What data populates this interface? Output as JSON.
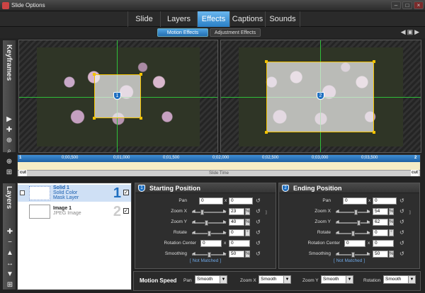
{
  "window": {
    "title": "Slide Options"
  },
  "tabs": [
    {
      "label": "Slide"
    },
    {
      "label": "Layers"
    },
    {
      "label": "Effects"
    },
    {
      "label": "Captions"
    },
    {
      "label": "Sounds"
    }
  ],
  "active_tab": "Effects",
  "subtabs": [
    {
      "label": "Motion Effects"
    },
    {
      "label": "Adjustment Effects"
    }
  ],
  "keyframes": {
    "label": "Keyframes",
    "start_badge": "1",
    "end_badge": "2"
  },
  "timeline": {
    "ticks": [
      "0;00,500",
      "0;01,000",
      "0;01,500",
      "0;02,000",
      "0;02,500",
      "0;03,000",
      "0;03,500"
    ],
    "footer": "Slide Time",
    "cut_left": "cut",
    "cut_right": "cut",
    "marker_left": "1",
    "marker_right": "2"
  },
  "layers": {
    "label": "Layers",
    "items": [
      {
        "name": "Solid 1",
        "line2": "Solid Color",
        "line3": "Mask Layer",
        "number": "1",
        "checked": true
      },
      {
        "name": "Image 1",
        "line2": "JPEG Image",
        "number": "2",
        "checked": true
      }
    ]
  },
  "starting": {
    "badge": "1",
    "title": "Starting Position",
    "pan_label": "Pan",
    "pan_x": "0",
    "pan_y": "0",
    "pan_sep": "x",
    "zoom_x_label": "Zoom X",
    "zoom_x": "23",
    "zoom_x_unit": "%",
    "zoom_y_label": "Zoom Y",
    "zoom_y": "40",
    "zoom_y_unit": "%",
    "rotate_label": "Rotate",
    "rotate": "0",
    "rotate_unit": "°",
    "center_label": "Rotation Center",
    "center_x": "0",
    "center_y": "0",
    "center_sep": "x",
    "smoothing_label": "Smoothing",
    "smoothing": "50",
    "smoothing_unit": "%",
    "not_matched": "[ Not Matched ]"
  },
  "ending": {
    "badge": "2",
    "title": "Ending Position",
    "pan_label": "Pan",
    "pan_x": "0",
    "pan_y": "0",
    "pan_sep": "x",
    "zoom_x_label": "Zoom X",
    "zoom_x": "54",
    "zoom_x_unit": "%",
    "zoom_y_label": "Zoom Y",
    "zoom_y": "62",
    "zoom_y_unit": "%",
    "rotate_label": "Rotate",
    "rotate": "0",
    "rotate_unit": "°",
    "center_label": "Rotation Center",
    "center_x": "0",
    "center_y": "0",
    "center_sep": "x",
    "smoothing_label": "Smoothing",
    "smoothing": "50",
    "smoothing_unit": "%",
    "not_matched": "[ Not Matched ]"
  },
  "motion_speed": {
    "title": "Motion Speed",
    "pan_label": "Pan",
    "pan_value": "Smooth",
    "zoom_x_label": "Zoom X",
    "zoom_x_value": "Smooth",
    "zoom_y_label": "Zoom Y",
    "zoom_y_value": "Smooth",
    "rotation_label": "Rotation",
    "rotation_value": "Smooth"
  },
  "colors": {
    "accent": "#2a7fc6",
    "guide": "#2fbf3a",
    "handle": "#f2c200"
  }
}
